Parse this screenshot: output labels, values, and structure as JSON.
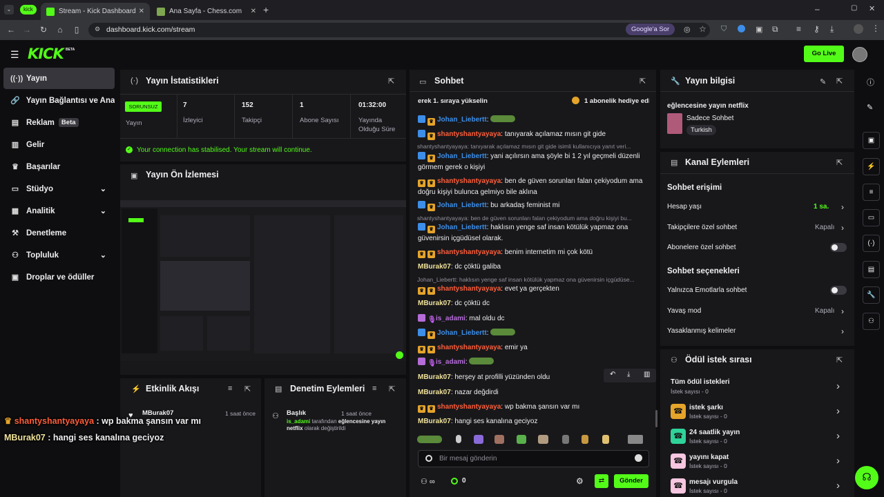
{
  "browser": {
    "profile_tab": "kick",
    "tabs": [
      {
        "title": "Stream - Kick Dashboard"
      },
      {
        "title": "Ana Sayfa - Chess.com"
      }
    ],
    "url": "dashboard.kick.com/stream",
    "google_button": "Google'a Sor"
  },
  "header": {
    "logo": "KICK",
    "logo_badge": "BETA",
    "go_live": "Go Live"
  },
  "sidebar": {
    "items": [
      {
        "label": "Yayın",
        "icon": "broadcast-icon"
      },
      {
        "label": "Yayın Bağlantısı ve Anahtarı",
        "icon": "link-icon"
      },
      {
        "label": "Reklam",
        "badge": "Beta",
        "icon": "ad-icon"
      },
      {
        "label": "Gelir",
        "icon": "chart-icon"
      },
      {
        "label": "Başarılar",
        "icon": "trophy-icon"
      },
      {
        "label": "Stüdyo",
        "icon": "studio-icon"
      },
      {
        "label": "Analitik",
        "icon": "analytics-icon"
      },
      {
        "label": "Denetleme",
        "icon": "hammer-icon"
      },
      {
        "label": "Topluluk",
        "icon": "community-icon"
      },
      {
        "label": "Droplar ve ödüller",
        "icon": "gift-icon"
      }
    ]
  },
  "stats": {
    "title": "Yayın İstatistikleri",
    "status_badge": "SORUNSUZ",
    "status_label": "Yayın",
    "items": [
      {
        "value": "7",
        "label": "İzleyici"
      },
      {
        "value": "152",
        "label": "Takipçi"
      },
      {
        "value": "1",
        "label": "Abone Sayısı"
      },
      {
        "value": "01:32:00",
        "label": "Yayında Olduğu Süre"
      }
    ],
    "connection_msg": "Your connection has stabilised. Your stream will continue."
  },
  "preview": {
    "title": "Yayın Ön İzlemesi"
  },
  "activity": {
    "title": "Etkinlik Akışı",
    "entry": {
      "user": "MBurak07",
      "time": "1 saat önce"
    }
  },
  "moderation": {
    "title": "Denetim Eylemleri",
    "entry": {
      "heading": "Başlık",
      "user": "is_adami",
      "text1": "tarafından",
      "highlight": "eğlencesine yayın netflix",
      "text2": "olarak değiştirildi",
      "time": "1 saat önce"
    }
  },
  "chat": {
    "title": "Sohbet",
    "ticker_left": "erek 1. sıraya yükselin",
    "ticker_right": "1 abonelik hediye edi",
    "messages": [
      {
        "user": "Johan_Liebertt",
        "color": "#3d8ee8",
        "text": "",
        "badges": [
          "blue",
          "gold"
        ],
        "emote": true
      },
      {
        "user": "shantyshantyayaya",
        "color": "#ff5e3a",
        "text": "tanıyarak açılamaz mısın git gide",
        "badges": [
          "blue",
          "gold"
        ]
      },
      {
        "reply": "shantyshantyayaya: tanıyarak açılamaz mısın git gide isimli kullanıcıya yanıt veri..."
      },
      {
        "user": "Johan_Liebertt",
        "color": "#3d8ee8",
        "text": "yani açılırsın ama şöyle bi 1 2 yıl geçmeli düzenli görmem gerek o kişiyi",
        "badges": [
          "blue",
          "gold"
        ]
      },
      {
        "user": "shantyshantyayaya",
        "color": "#ff5e3a",
        "text": "ben de güven sorunları falan çekiyodum ama doğru kişiyi bulunca gelmiyo bile aklına",
        "badges": [
          "gold",
          "gold"
        ]
      },
      {
        "user": "Johan_Liebertt",
        "color": "#3d8ee8",
        "text": "bu arkadaş feminist mi",
        "badges": [
          "blue",
          "gold"
        ]
      },
      {
        "reply": "shantyshantyayaya: ben de güven sorunları falan çekiyodum ama doğru kişiyi bu..."
      },
      {
        "user": "Johan_Liebertt",
        "color": "#3d8ee8",
        "text": "haklısın yenge saf insan kötülük yapmaz ona güvenirsin içgüdüsel olarak.",
        "badges": [
          "blue",
          "gold"
        ]
      },
      {
        "user": "shantyshantyayaya",
        "color": "#ff5e3a",
        "text": "benim internetim mi çok kötü",
        "badges": [
          "gold",
          "gold"
        ]
      },
      {
        "user": "MBurak07",
        "color": "#f0e29a",
        "text": "dc çöktü galiba",
        "badges": []
      },
      {
        "reply": "Johan_Liebertt: haklısın yenge saf insan kötülük yapmaz ona güvenirsin içgüdüse..."
      },
      {
        "user": "shantyshantyayaya",
        "color": "#ff5e3a",
        "text": "evet ya gerçekten",
        "badges": [
          "gold",
          "gold"
        ]
      },
      {
        "user": "MBurak07",
        "color": "#f0e29a",
        "text": "dc çöktü dc",
        "badges": []
      },
      {
        "user": "is_adami",
        "color": "#b56cd8",
        "text": "mal oldu dc",
        "badges": [
          "pink",
          "mic"
        ]
      },
      {
        "user": "Johan_Liebertt",
        "color": "#3d8ee8",
        "text": "",
        "badges": [
          "blue",
          "gold"
        ],
        "emote": true
      },
      {
        "user": "shantyshantyayaya",
        "color": "#ff5e3a",
        "text": "emir ya",
        "badges": [
          "gold",
          "gold"
        ]
      },
      {
        "user": "is_adami",
        "color": "#b56cd8",
        "text": "",
        "badges": [
          "pink",
          "mic"
        ],
        "emote": true
      },
      {
        "user": "MBurak07",
        "color": "#f0e29a",
        "text": "herşey at profilli yüzünden oldu",
        "badges": []
      },
      {
        "user": "MBurak07",
        "color": "#f0e29a",
        "text": "nazar değdirdi",
        "badges": []
      },
      {
        "user": "shantyshantyayaya",
        "color": "#ff5e3a",
        "text": "wp bakma şansın var mı",
        "badges": [
          "gold",
          "gold"
        ]
      },
      {
        "user": "MBurak07",
        "color": "#f0e29a",
        "text": "hangi ses kanalına geciyoz",
        "badges": []
      }
    ],
    "input_placeholder": "Bir mesaj gönderin",
    "points": "0",
    "send_button": "Gönder"
  },
  "stream_info": {
    "title": "Yayın bilgisi",
    "stream_title": "eğlencesine yayın netflix",
    "category": "Sadece Sohbet",
    "tag": "Turkish"
  },
  "channel_actions": {
    "title": "Kanal Eylemleri",
    "chat_access": "Sohbet erişimi",
    "account_age": {
      "label": "Hesap yaşı",
      "value": "1 sa."
    },
    "followers_only": {
      "label": "Takipçilere özel sohbet",
      "value": "Kapalı"
    },
    "subscribers_only": {
      "label": "Abonelere özel sohbet"
    },
    "chat_options": "Sohbet seçenekleri",
    "emote_only": {
      "label": "Yalnızca Emotlarla sohbet"
    },
    "slow_mode": {
      "label": "Yavaş mod",
      "value": "Kapalı"
    },
    "banned_words": {
      "label": "Yasaklanmış kelimeler"
    }
  },
  "rewards": {
    "title": "Ödül istek sırası",
    "all": {
      "label": "Tüm ödül istekleri",
      "count": "İstek sayısı - 0"
    },
    "items": [
      {
        "label": "istek şarkı",
        "count": "İstek sayısı - 0",
        "color": "#e5a42a"
      },
      {
        "label": "24 saatlik yayın",
        "count": "İstek sayısı - 0",
        "color": "#2fd39a"
      },
      {
        "label": "yayını kapat",
        "count": "İstek sayısı - 0",
        "color": "#f7c6e0"
      },
      {
        "label": "mesajı vurgula",
        "count": "İstek sayısı - 0",
        "color": "#f7c6e0"
      }
    ]
  },
  "overlay": {
    "line1_user": "shantyshantyayaya",
    "line1_text": ": wp bakma şansın var mı",
    "line2_user": "MBurak07",
    "line2_text": ": hangi ses kanalına geciyoz"
  },
  "colors": {
    "accent": "#53fc18",
    "panel": "#18181b",
    "bg": "#0e0e10"
  }
}
